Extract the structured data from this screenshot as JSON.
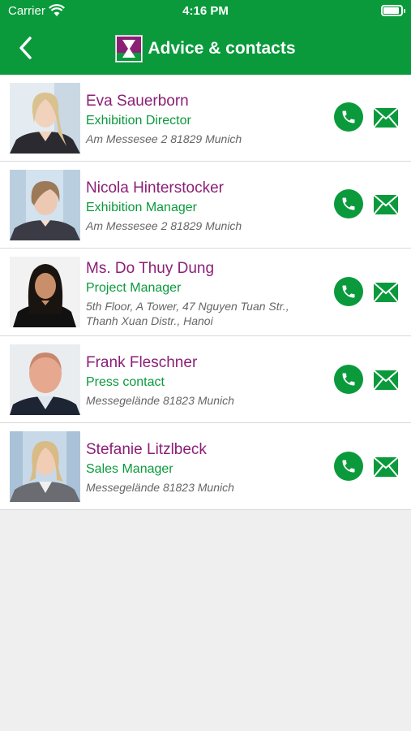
{
  "status": {
    "carrier": "Carrier",
    "time": "4:16 PM"
  },
  "nav": {
    "title": "Advice & contacts"
  },
  "colors": {
    "header": "#0a9a3c",
    "name": "#8b1f76",
    "role": "#0a9a3c"
  },
  "contacts": [
    {
      "name": "Eva Sauerborn",
      "role": "Exhibition Director",
      "address": "Am Messesee 2 81829 Munich"
    },
    {
      "name": "Nicola Hinterstocker",
      "role": "Exhibition Manager",
      "address": "Am Messesee 2 81829 Munich"
    },
    {
      "name": "Ms. Do Thuy Dung",
      "role": "Project Manager",
      "address": "5th Floor, A Tower, 47 Nguyen Tuan Str., Thanh Xuan Distr., Hanoi"
    },
    {
      "name": "Frank Fleschner",
      "role": "Press contact",
      "address": "Messegelände 81823 Munich"
    },
    {
      "name": "Stefanie Litzlbeck",
      "role": "Sales Manager",
      "address": "Messegelände 81823 Munich"
    }
  ]
}
